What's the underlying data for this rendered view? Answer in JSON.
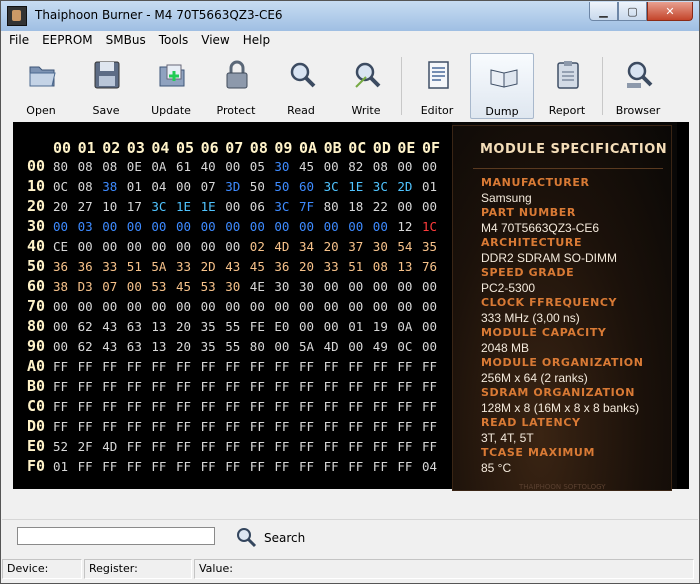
{
  "window": {
    "title": "Thaiphoon Burner - M4 70T5663QZ3-CE6",
    "buttons": [
      "minimize",
      "maximize",
      "close"
    ]
  },
  "menu": [
    {
      "label": "File"
    },
    {
      "label": "EEPROM"
    },
    {
      "label": "SMBus"
    },
    {
      "label": "Tools"
    },
    {
      "label": "View"
    },
    {
      "label": "Help"
    }
  ],
  "toolbar": [
    {
      "label": "Open",
      "icon": "folder-open-icon"
    },
    {
      "label": "Save",
      "icon": "floppy-disk-icon"
    },
    {
      "label": "Update",
      "icon": "update-folder-icon"
    },
    {
      "label": "Protect",
      "icon": "lock-icon"
    },
    {
      "label": "Read",
      "icon": "magnifier-read-icon"
    },
    {
      "label": "Write",
      "icon": "magnifier-write-icon"
    },
    {
      "label": "Editor",
      "icon": "document-editor-icon"
    },
    {
      "label": "Dump",
      "icon": "open-book-icon"
    },
    {
      "label": "Report",
      "icon": "clipboard-report-icon"
    },
    {
      "label": "Browser",
      "icon": "browser-magnifier-icon"
    }
  ],
  "hex": {
    "columns": [
      "00",
      "01",
      "02",
      "03",
      "04",
      "05",
      "06",
      "07",
      "08",
      "09",
      "0A",
      "0B",
      "0C",
      "0D",
      "0E",
      "0F"
    ],
    "rows": [
      {
        "label": "00",
        "bytes": [
          "80",
          "08",
          "08",
          "0E",
          "0A",
          "61",
          "40",
          "00",
          "05",
          "30",
          "45",
          "00",
          "82",
          "08",
          "00",
          "00"
        ]
      },
      {
        "label": "10",
        "bytes": [
          "0C",
          "08",
          "38",
          "01",
          "04",
          "00",
          "07",
          "3D",
          "50",
          "50",
          "60",
          "3C",
          "1E",
          "3C",
          "2D",
          "01"
        ]
      },
      {
        "label": "20",
        "bytes": [
          "20",
          "27",
          "10",
          "17",
          "3C",
          "1E",
          "1E",
          "00",
          "06",
          "3C",
          "7F",
          "80",
          "18",
          "22",
          "00",
          "00"
        ]
      },
      {
        "label": "30",
        "bytes": [
          "00",
          "03",
          "00",
          "00",
          "00",
          "00",
          "00",
          "00",
          "00",
          "00",
          "00",
          "00",
          "00",
          "00",
          "12",
          "1C"
        ]
      },
      {
        "label": "40",
        "bytes": [
          "CE",
          "00",
          "00",
          "00",
          "00",
          "00",
          "00",
          "00",
          "02",
          "4D",
          "34",
          "20",
          "37",
          "30",
          "54",
          "35"
        ]
      },
      {
        "label": "50",
        "bytes": [
          "36",
          "36",
          "33",
          "51",
          "5A",
          "33",
          "2D",
          "43",
          "45",
          "36",
          "20",
          "33",
          "51",
          "08",
          "13",
          "76"
        ]
      },
      {
        "label": "60",
        "bytes": [
          "38",
          "D3",
          "07",
          "00",
          "53",
          "45",
          "53",
          "30",
          "4E",
          "30",
          "30",
          "00",
          "00",
          "00",
          "00",
          "00"
        ]
      },
      {
        "label": "70",
        "bytes": [
          "00",
          "00",
          "00",
          "00",
          "00",
          "00",
          "00",
          "00",
          "00",
          "00",
          "00",
          "00",
          "00",
          "00",
          "00",
          "00"
        ]
      },
      {
        "label": "80",
        "bytes": [
          "00",
          "62",
          "43",
          "63",
          "13",
          "20",
          "35",
          "55",
          "FE",
          "E0",
          "00",
          "00",
          "01",
          "19",
          "0A",
          "00"
        ]
      },
      {
        "label": "90",
        "bytes": [
          "00",
          "62",
          "43",
          "63",
          "13",
          "20",
          "35",
          "55",
          "80",
          "00",
          "5A",
          "4D",
          "00",
          "49",
          "0C",
          "00"
        ]
      },
      {
        "label": "A0",
        "bytes": [
          "FF",
          "FF",
          "FF",
          "FF",
          "FF",
          "FF",
          "FF",
          "FF",
          "FF",
          "FF",
          "FF",
          "FF",
          "FF",
          "FF",
          "FF",
          "FF"
        ]
      },
      {
        "label": "B0",
        "bytes": [
          "FF",
          "FF",
          "FF",
          "FF",
          "FF",
          "FF",
          "FF",
          "FF",
          "FF",
          "FF",
          "FF",
          "FF",
          "FF",
          "FF",
          "FF",
          "FF"
        ]
      },
      {
        "label": "C0",
        "bytes": [
          "FF",
          "FF",
          "FF",
          "FF",
          "FF",
          "FF",
          "FF",
          "FF",
          "FF",
          "FF",
          "FF",
          "FF",
          "FF",
          "FF",
          "FF",
          "FF"
        ]
      },
      {
        "label": "D0",
        "bytes": [
          "FF",
          "FF",
          "FF",
          "FF",
          "FF",
          "FF",
          "FF",
          "FF",
          "FF",
          "FF",
          "FF",
          "FF",
          "FF",
          "FF",
          "FF",
          "FF"
        ]
      },
      {
        "label": "E0",
        "bytes": [
          "52",
          "2F",
          "4D",
          "FF",
          "FF",
          "FF",
          "FF",
          "FF",
          "FF",
          "FF",
          "FF",
          "FF",
          "FF",
          "FF",
          "FF",
          "FF"
        ]
      },
      {
        "label": "F0",
        "bytes": [
          "01",
          "FF",
          "FF",
          "FF",
          "FF",
          "FF",
          "FF",
          "FF",
          "FF",
          "FF",
          "FF",
          "FF",
          "FF",
          "FF",
          "FF",
          "04"
        ]
      }
    ],
    "colors": {
      "white": "#d8d8d8",
      "blue": "#3e8bff",
      "cyan": "#50c4ff",
      "orange": "#f7c28a",
      "red": "#ff3b3b",
      "header": "#fff3c9"
    },
    "color_map": {
      "0": "wwwwwwwwwbwwwwww",
      "1": "wwbwwwwbwbbccccw",
      "2": "wwwwcccwwbbwwwww",
      "3": "bbbbbbbbbbbbbbwr",
      "4": "wwwwwwwwoooooooo",
      "5": "oooooooooooooooo",
      "6": "oooooooowwwwwwww",
      "7": "wwwwwwwwwwwwwwww",
      "8": "wwwwwwwwwwwwwwww",
      "9": "wwwwwwwwwwwwwwww",
      "10": "wwwwwwwwwwwwwwww",
      "11": "wwwwwwwwwwwwwwww",
      "12": "wwwwwwwwwwwwwwww",
      "13": "wwwwwwwwwwwwwwww",
      "14": "wwwwwwwwwwwwwwww",
      "15": "wwwwwwwwwwwwwwww"
    }
  },
  "spec": {
    "title": "MODULE SPECIFICATION",
    "items": [
      {
        "label": "MANUFACTURER",
        "value": "Samsung"
      },
      {
        "label": "PART NUMBER",
        "value": "M4 70T5663QZ3-CE6"
      },
      {
        "label": "ARCHITECTURE",
        "value": "DDR2 SDRAM SO-DIMM"
      },
      {
        "label": "SPEED GRADE",
        "value": "PC2-5300"
      },
      {
        "label": "CLOCK FFREQUENCY",
        "value": "333 MHz (3,00 ns)"
      },
      {
        "label": "MODULE CAPACITY",
        "value": "2048 MB"
      },
      {
        "label": "MODULE ORGANIZATION",
        "value": "256M x 64 (2 ranks)"
      },
      {
        "label": "SDRAM ORGANIZATION",
        "value": "128M x 8 (16M x 8 x 8 banks)"
      },
      {
        "label": "READ LATENCY",
        "value": "3T, 4T, 5T"
      },
      {
        "label": "TCASE MAXIMUM",
        "value": "85 °C"
      }
    ],
    "footer": "THAIPHOON SOFTOLOGY"
  },
  "search": {
    "value": "",
    "button_label": "Search"
  },
  "status": [
    {
      "label": "Device:"
    },
    {
      "label": "Register:"
    },
    {
      "label": "Value:"
    }
  ]
}
